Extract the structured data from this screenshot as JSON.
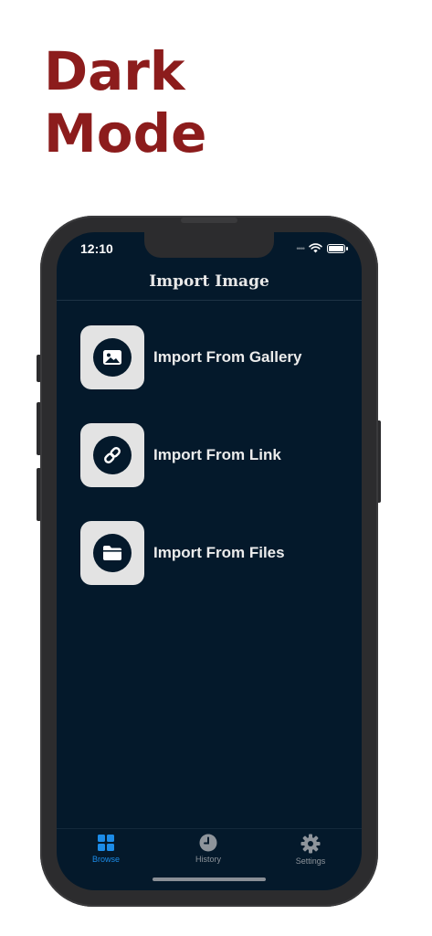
{
  "promo": {
    "line1": "Dark",
    "line2": "Mode"
  },
  "status_bar": {
    "time": "12:10",
    "signal": "••••"
  },
  "nav": {
    "title": "Import Image"
  },
  "import_options": [
    {
      "label": "Import From Gallery",
      "icon": "photo-icon"
    },
    {
      "label": "Import From Link",
      "icon": "link-icon"
    },
    {
      "label": "Import From Files",
      "icon": "folder-icon"
    }
  ],
  "tabs": [
    {
      "label": "Browse",
      "icon": "grid-icon",
      "selected": true
    },
    {
      "label": "History",
      "icon": "clock-icon",
      "selected": false
    },
    {
      "label": "Settings",
      "icon": "gear-icon",
      "selected": false
    }
  ],
  "colors": {
    "headline": "#8c1c1c",
    "screen_background": "#04192b",
    "tab_active": "#1c8ce8",
    "tab_inactive": "#8e949b",
    "tile": "#e3e3e3"
  }
}
